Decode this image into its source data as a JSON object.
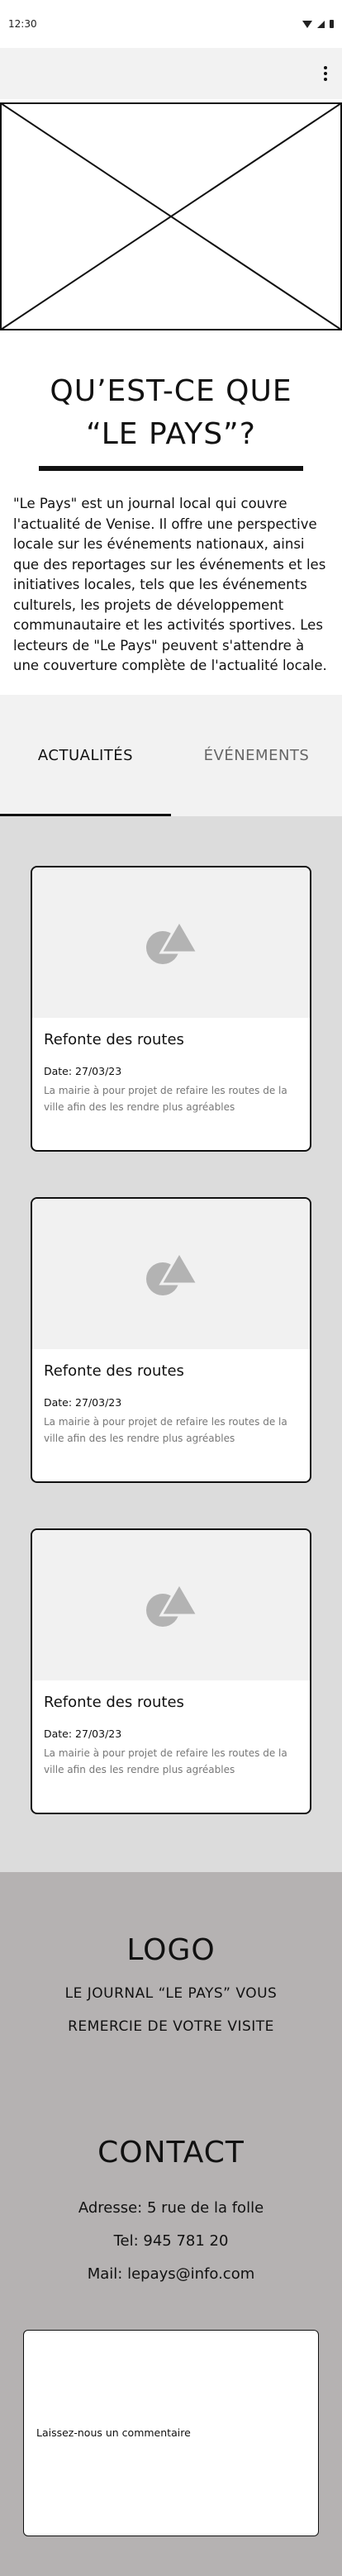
{
  "status_bar": {
    "time": "12:30"
  },
  "about": {
    "title_line1": "QU’EST-CE QUE",
    "title_line2": "“LE PAYS”?",
    "body": "\"Le Pays\" est un journal local qui couvre l'actualité de Venise. Il offre une perspective locale sur les événements nationaux, ainsi que des reportages sur les événements et les initiatives locales, tels que les événements culturels, les projets de développement communautaire et les activités sportives. Les lecteurs de \"Le Pays\" peuvent s'attendre à une couverture complète de l'actualité locale."
  },
  "tabs": [
    {
      "label": "ACTUALITÉS",
      "active": true
    },
    {
      "label": "ÉVÉNEMENTS",
      "active": false
    }
  ],
  "articles": [
    {
      "title": "Refonte des routes",
      "date": "Date: 27/03/23",
      "description": "La mairie à pour projet de refaire les routes de la ville afin des les rendre plus agréables"
    },
    {
      "title": "Refonte des routes",
      "date": "Date: 27/03/23",
      "description": "La mairie à pour projet de refaire les routes de la ville afin des les rendre plus agréables"
    },
    {
      "title": "Refonte des routes",
      "date": "Date: 27/03/23",
      "description": "La mairie à pour projet de refaire les routes de la ville afin des les rendre plus agréables"
    }
  ],
  "footer": {
    "logo": "LOGO",
    "thanks_line1": "LE JOURNAL “LE PAYS” VOUS",
    "thanks_line2": "REMERCIE DE VOTRE VISITE",
    "contact_title": "CONTACT",
    "address": "Adresse: 5 rue de la folle",
    "phone": "Tel: 945 781 20",
    "mail": "Mail: lepays@info.com",
    "comment_placeholder": "Laissez-nous un commentaire"
  },
  "icons": {
    "menu": "more-vert-icon",
    "card_media": "shapes-placeholder-icon"
  },
  "colors": {
    "app_bar": "#f2f2f2",
    "news_bg": "#dcdcdc",
    "footer_bg": "#b5b2b2",
    "placeholder_grey": "#b3b3b3"
  }
}
